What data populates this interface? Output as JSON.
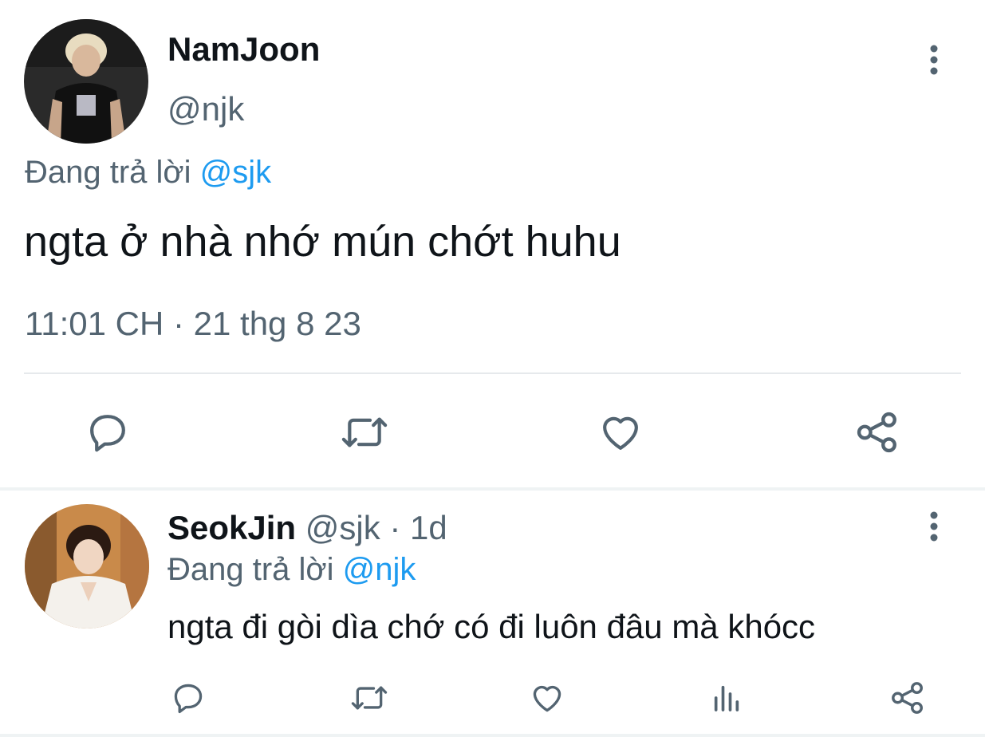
{
  "main_tweet": {
    "display_name": "NamJoon",
    "handle": "@njk",
    "replying_prefix": "Đang trả lời ",
    "replying_to": "@sjk",
    "text": "ngta ở nhà nhớ mún chớt huhu",
    "timestamp": "11:01 CH · 21 thg 8 23",
    "avatar_icon": "user-photo-avatar",
    "actions": [
      "reply-icon",
      "retweet-icon",
      "like-icon",
      "share-icon"
    ]
  },
  "reply_tweet": {
    "display_name": "SeokJin",
    "handle": "@sjk",
    "separator": " · ",
    "age": "1d",
    "replying_prefix": "Đang trả lời ",
    "replying_to": "@njk",
    "text": "ngta đi gòi dìa chớ có đi luôn đâu mà khócc",
    "avatar_icon": "user-photo-avatar",
    "actions": [
      "reply-icon",
      "retweet-icon",
      "like-icon",
      "views-icon",
      "share-icon"
    ]
  },
  "colors": {
    "text_primary": "#0f1419",
    "text_secondary": "#536471",
    "mention": "#1d9bf0",
    "icon": "#536471",
    "divider": "#e6e9ec"
  }
}
